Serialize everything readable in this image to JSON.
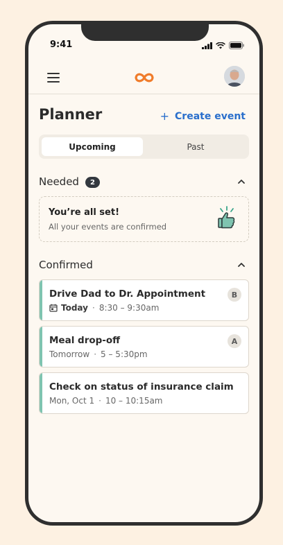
{
  "status": {
    "time": "9:41"
  },
  "header": {
    "title": "Planner",
    "create_label": "Create event",
    "create_icon": "plus-icon"
  },
  "tabs": [
    {
      "label": "Upcoming",
      "active": true
    },
    {
      "label": "Past",
      "active": false
    }
  ],
  "needed": {
    "title": "Needed",
    "count": "2",
    "empty_title": "You’re all set!",
    "empty_subtitle": "All your events are confirmed"
  },
  "confirmed": {
    "title": "Confirmed",
    "events": [
      {
        "title": "Drive Dad to Dr. Appointment",
        "day": "Today",
        "time": "8:30 – 9:30am",
        "badge": "B",
        "show_calendar_icon": true
      },
      {
        "title": "Meal drop-off",
        "day": "Tomorrow",
        "time": "5 – 5:30pm",
        "badge": "A",
        "show_calendar_icon": false
      },
      {
        "title": "Check on status of insurance claim",
        "day": "Mon, Oct 1",
        "time": "10 – 10:15am",
        "badge": "",
        "show_calendar_icon": false
      }
    ]
  },
  "colors": {
    "accent": "#2a6fcc",
    "brand": "#f07c2b",
    "stripe": "#7fc4b0",
    "background": "#fdf1e2"
  }
}
